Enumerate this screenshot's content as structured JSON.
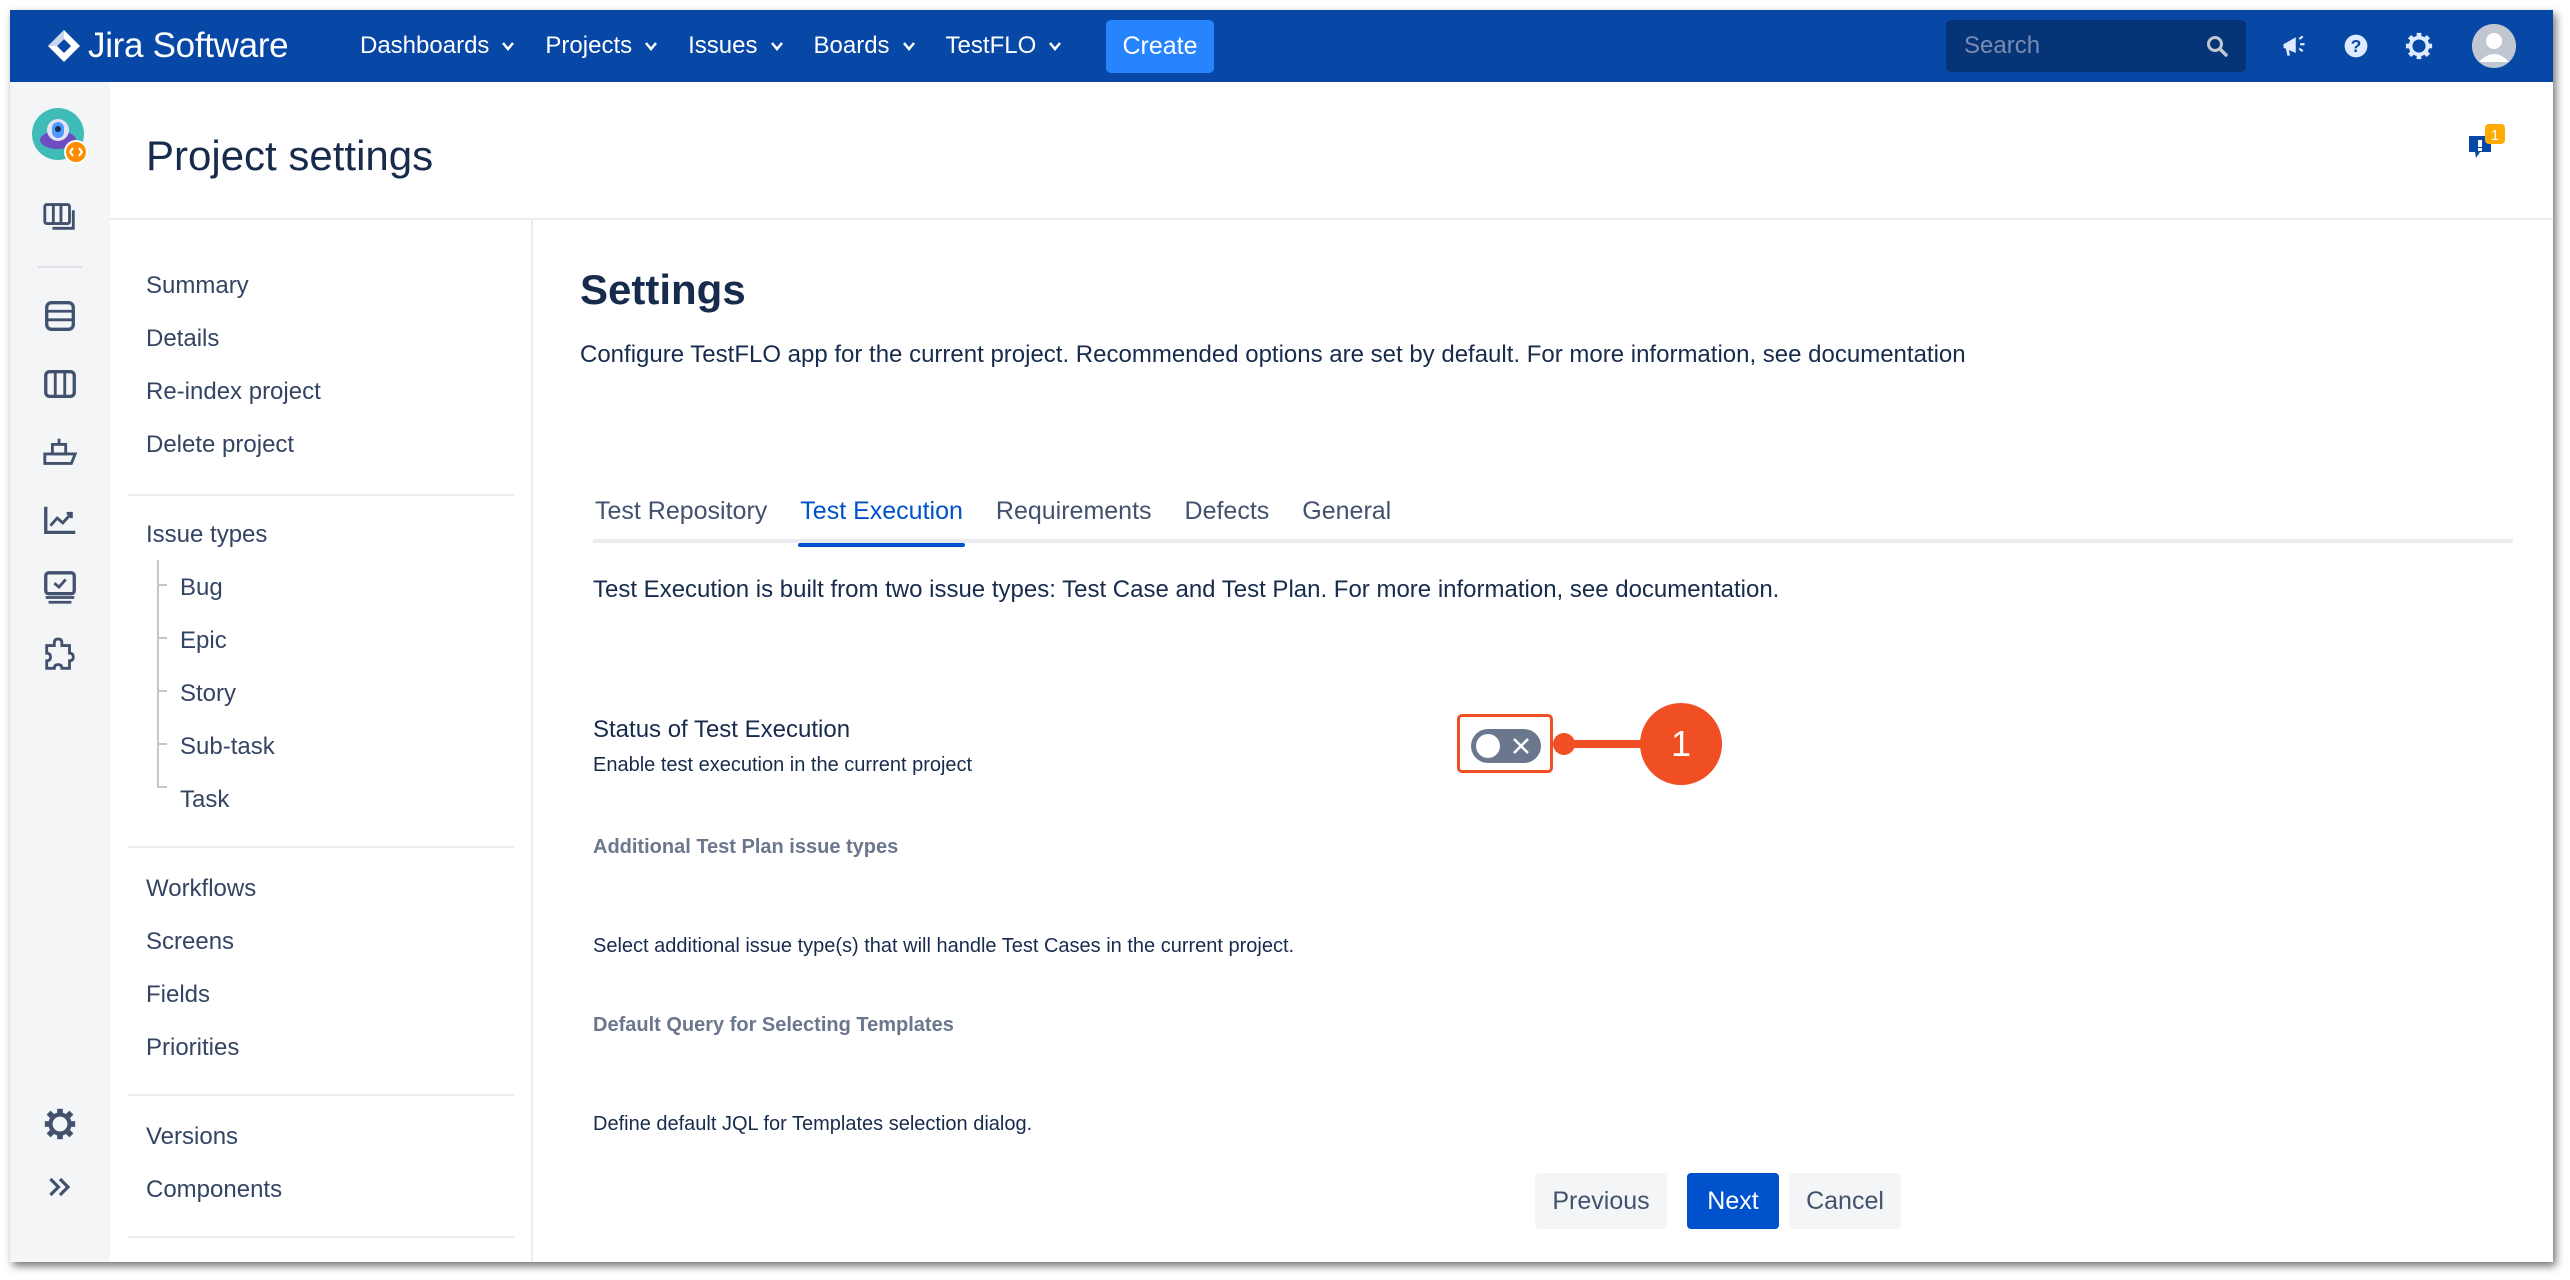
{
  "topbar": {
    "brand": "Jira Software",
    "nav": [
      {
        "label": "Dashboards"
      },
      {
        "label": "Projects"
      },
      {
        "label": "Issues"
      },
      {
        "label": "Boards"
      },
      {
        "label": "TestFLO"
      }
    ],
    "create_label": "Create",
    "search_placeholder": "Search",
    "icons": [
      "megaphone-icon",
      "help-icon",
      "settings-icon",
      "user-avatar"
    ],
    "colors": {
      "bar": "#0747a6",
      "create": "#2684ff"
    }
  },
  "iconbar": {
    "items": [
      "project-avatar",
      "board-icon",
      "backlog-icon",
      "active-sprints-icon",
      "releases-icon",
      "reports-icon",
      "tests-icon",
      "add-ons-icon"
    ],
    "bottom": [
      "project-settings-icon",
      "expand-sidebar-icon"
    ]
  },
  "header": {
    "title": "Project settings",
    "notification_count": "1"
  },
  "leftnav": {
    "group1": [
      "Summary",
      "Details",
      "Re-index project",
      "Delete project"
    ],
    "issue_types_label": "Issue types",
    "issue_types": [
      "Bug",
      "Epic",
      "Story",
      "Sub-task",
      "Task"
    ],
    "group3": [
      "Workflows",
      "Screens",
      "Fields",
      "Priorities"
    ],
    "group4": [
      "Versions",
      "Components"
    ]
  },
  "main": {
    "title": "Settings",
    "description": "Configure TestFLO app for the current project. Recommended options are set by default. For more information, see documentation",
    "tabs": [
      {
        "label": "Test Repository",
        "active": false
      },
      {
        "label": "Test Execution",
        "active": true
      },
      {
        "label": "Requirements",
        "active": false
      },
      {
        "label": "Defects",
        "active": false
      },
      {
        "label": "General",
        "active": false
      }
    ],
    "tab_description": "Test Execution is built from two issue types: Test Case and Test Plan. For more information, see documentation.",
    "status_label": "Status of Test Execution",
    "status_sub": "Enable test execution in the current project",
    "status_enabled": false,
    "additional_label": "Additional Test Plan issue types",
    "additional_sub": "Select additional issue type(s) that will handle Test Cases in the current project.",
    "query_label": "Default Query for Selecting Templates",
    "query_sub": "Define default JQL for Templates selection dialog.",
    "callout_number": "1",
    "buttons": {
      "previous": "Previous",
      "next": "Next",
      "cancel": "Cancel"
    },
    "colors": {
      "accent": "#0052cc",
      "callout": "#f04e23",
      "toggle_off": "#6b778c"
    }
  }
}
